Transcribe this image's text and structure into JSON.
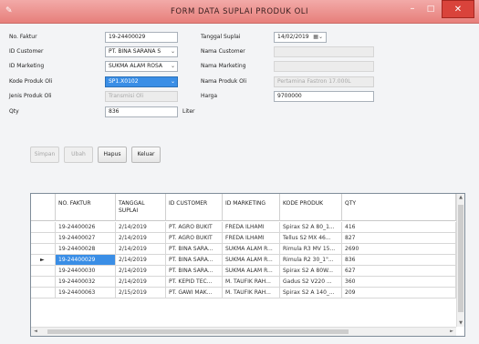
{
  "window": {
    "title": "FORM DATA SUPLAI PRODUK OLI",
    "minimize_glyph": "–",
    "maximize_glyph": "□",
    "close_glyph": "✕",
    "close_color": "#d9433b",
    "title_bar_color": "#ec9895"
  },
  "form": {
    "no_faktur_label": "No. Faktur",
    "no_faktur_value": "19-24400029",
    "id_customer_label": "ID Customer",
    "id_customer_value": "PT. BINA SARANA S",
    "id_marketing_label": "ID Marketing",
    "id_marketing_value": "SUKMA ALAM ROSA",
    "kode_produk_label": "Kode Produk Oli",
    "kode_produk_value": "SP1.X0102",
    "jenis_produk_label": "Jenis Produk Oli",
    "jenis_produk_placeholder": "Transmisi Oli",
    "qty_label": "Qty",
    "qty_value": "836",
    "qty_unit": "Liter",
    "tanggal_label": "Tanggal Suplai",
    "tanggal_value": "14/02/2019",
    "nama_customer_label": "Nama Customer",
    "nama_marketing_label": "Nama Marketing",
    "nama_produk_label": "Nama Produk Oli",
    "nama_produk_placeholder": "Pertamina Fastron 17.000L",
    "harga_label": "Harga",
    "harga_value": "9700000"
  },
  "buttons": {
    "simpan": "Simpan",
    "ubah": "Ubah",
    "hapus": "Hapus",
    "keluar": "Keluar"
  },
  "grid": {
    "selected_color": "#3a8ee6",
    "columns": [
      "NO. FAKTUR",
      "TANGGAL SUPLAI",
      "ID CUSTOMER",
      "ID MARKETING",
      "KODE PRODUK",
      "QTY"
    ],
    "rows": [
      [
        "19-24400026",
        "2/14/2019",
        "PT. AGRO BUKIT",
        "FREDA ILHAMI",
        "Spirax S2 A 80_1...",
        "416"
      ],
      [
        "19-24400027",
        "2/14/2019",
        "PT. AGRO BUKIT",
        "FREDA ILHAMI",
        "Tellus S2 MX 46...",
        "827"
      ],
      [
        "19-24400028",
        "2/14/2019",
        "PT. BINA SARA...",
        "SUKMA ALAM R...",
        "Rimula R3 MV 15...",
        "2690"
      ],
      [
        "19-24400029",
        "2/14/2019",
        "PT. BINA SARA...",
        "SUKMA ALAM R...",
        "Rimula R2 30_1\"...",
        "836"
      ],
      [
        "19-24400030",
        "2/14/2019",
        "PT. BINA SARA...",
        "SUKMA ALAM R...",
        "Spirax S2 A 80W...",
        "627"
      ],
      [
        "19-24400032",
        "2/14/2019",
        "PT. KEPID TEC...",
        "M. TAUFIK RAH...",
        "Gadus S2 V220 ...",
        "360"
      ],
      [
        "19-24400063",
        "2/15/2019",
        "PT. GAWI MAK...",
        "M. TAUFIK RAH...",
        "Spirax S2 A 140_...",
        "209"
      ]
    ],
    "selected_row_indicator": "►"
  }
}
